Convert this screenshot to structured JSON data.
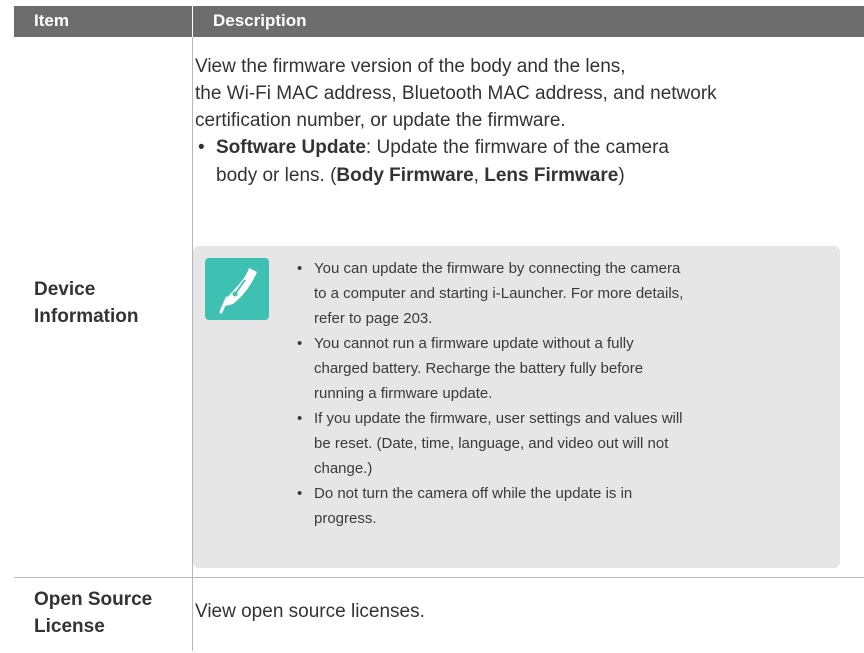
{
  "header": {
    "item": "Item",
    "description": "Description"
  },
  "rows": [
    {
      "item_lines": [
        "Device",
        "Information"
      ],
      "description_lines": [
        "View the firmware version of the body and the lens,",
        "the Wi-Fi MAC address, Bluetooth MAC address, and network",
        "certification number, or update the firmware."
      ],
      "bullet": {
        "term": "Software Update",
        "text_before": ": Update the firmware of the camera",
        "line2_before": "body or lens. (",
        "option1": "Body Firmware",
        "sep": ", ",
        "option2": "Lens Firmware",
        "line2_after": ")"
      },
      "note": {
        "icon": "note-pen-icon",
        "items": [
          {
            "lines": [
              "You can update the firmware by connecting the camera",
              "to a computer and starting i-Launcher. For more details,",
              "refer to page 203."
            ]
          },
          {
            "lines": [
              "You cannot run a firmware update without a fully",
              "charged battery. Recharge the battery fully before",
              "running a firmware update."
            ]
          },
          {
            "lines": [
              "If you update the firmware, user settings and values will",
              "be reset. (Date, time, language, and video out will not",
              "change.)"
            ]
          },
          {
            "lines": [
              "Do not turn the camera off while the update is in",
              "progress."
            ]
          }
        ]
      }
    },
    {
      "item_lines": [
        "Open Source",
        "License"
      ],
      "description": "View open source licenses."
    }
  ],
  "colors": {
    "header_bg": "#6d6d6d",
    "note_bg": "#e6e6e6",
    "icon_bg": "#3ec0b3",
    "divider": "#b7b7b7"
  }
}
